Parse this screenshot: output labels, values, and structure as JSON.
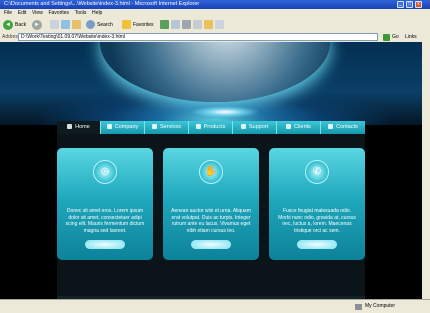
{
  "window": {
    "title": "C:\\Documents and Settings\\...\\Website\\index-3.html - Microsoft Internet Explorer",
    "min": "_",
    "max": "□",
    "close": "x"
  },
  "menu": [
    "File",
    "Edit",
    "View",
    "Favorites",
    "Tools",
    "Help"
  ],
  "toolbar": {
    "back_label": "Back",
    "search_label": "Search",
    "favorites_label": "Favorites"
  },
  "address": {
    "label": "Address",
    "value": "D:\\Work\\Testing\\01.09.07\\Website\\index-3.html",
    "go_label": "Go",
    "links_label": "Links"
  },
  "nav": {
    "tabs": [
      {
        "label": "Home",
        "icon": "home-icon"
      },
      {
        "label": "Company",
        "icon": "company-icon"
      },
      {
        "label": "Services",
        "icon": "services-icon"
      },
      {
        "label": "Products",
        "icon": "products-icon"
      },
      {
        "label": "Support",
        "icon": "support-icon"
      },
      {
        "label": "Clients",
        "icon": "clients-icon"
      },
      {
        "label": "Contacts",
        "icon": "contacts-icon"
      }
    ],
    "active": "Home"
  },
  "cards": [
    {
      "icon": "clock-icon",
      "glyph": "◷",
      "text": "Donec sit amet eros. Lorem ipsum dolor sit amet, consectetuer adipi scing elit. Mauris fermentum dictum magna sed laoreet."
    },
    {
      "icon": "hand-icon",
      "glyph": "✋",
      "text": "Aenean auctor wisi et urna. Aliquam erat volutpat. Duis ac turpis. Integer rutrum ante eu lacus. Vivamus eget nibh etiam cursus leo."
    },
    {
      "icon": "phone-icon",
      "glyph": "✆",
      "text": "Fusce feugiat malesuada odio. Morbi nunc odio, gravida at, cursus nec, luctus a, lorem. Maecenas tristique orci ac sem."
    }
  ],
  "status": {
    "left": "",
    "zone": "My Computer"
  }
}
